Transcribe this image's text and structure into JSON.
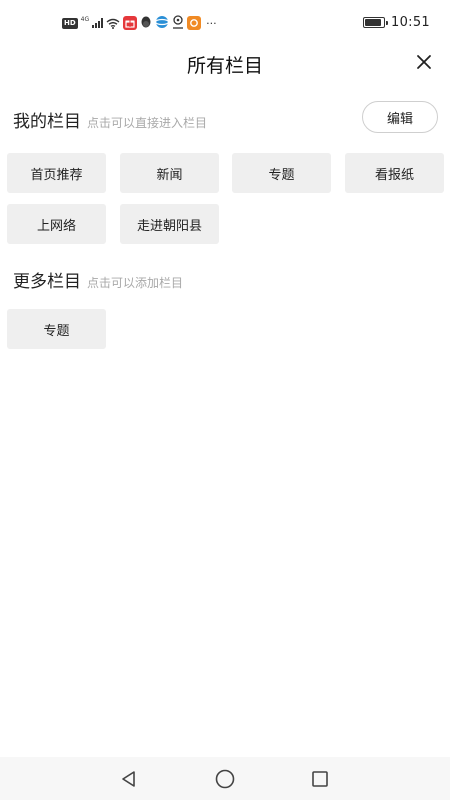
{
  "status_bar": {
    "hd": "HD",
    "network": "4G",
    "more": "···",
    "time": "10:51",
    "battery_level": 0.9,
    "app_icons": [
      "gift-app-icon",
      "qq-penguin-icon",
      "browser-app-icon",
      "location-app-icon",
      "orange-app-icon"
    ]
  },
  "header": {
    "title": "所有栏目",
    "close_icon": "close-icon"
  },
  "my_columns": {
    "title": "我的栏目",
    "hint": "点击可以直接进入栏目",
    "edit_label": "编辑",
    "items": [
      "首页推荐",
      "新闻",
      "专题",
      "看报纸",
      "上网络",
      "走进朝阳县"
    ]
  },
  "more_columns": {
    "title": "更多栏目",
    "hint": "点击可以添加栏目",
    "items": [
      "专题"
    ]
  },
  "nav_bar": {
    "back_icon": "back-triangle-icon",
    "home_icon": "home-circle-icon",
    "recents_icon": "recents-square-icon"
  },
  "colors": {
    "chip_bg": "#efefef",
    "hint_text": "#a9a9a9",
    "nav_bg": "#f7f7f7"
  }
}
